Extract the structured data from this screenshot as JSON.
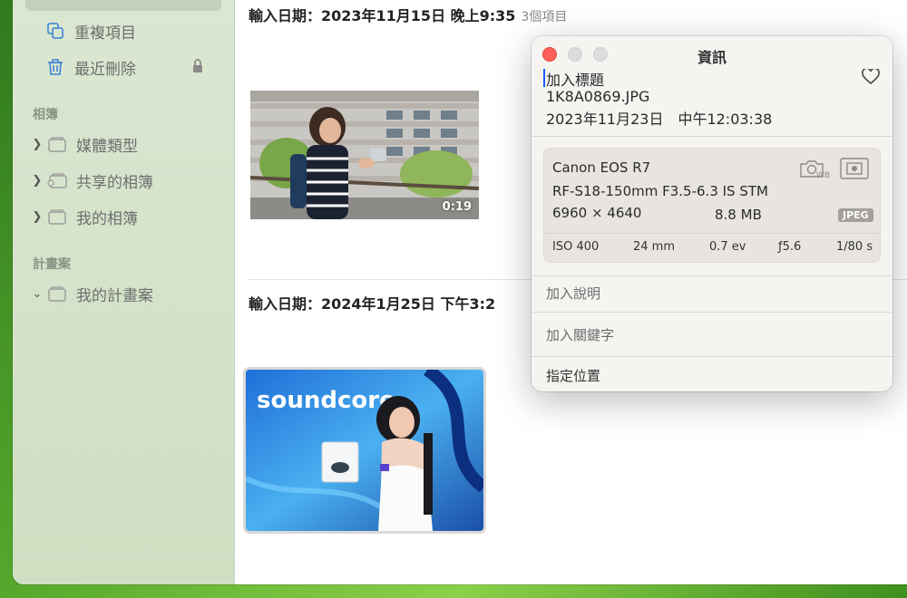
{
  "sidebar": {
    "items": [
      {
        "label": "重複項目",
        "icon": "duplicate-icon"
      },
      {
        "label": "最近刪除",
        "icon": "trash-icon"
      }
    ],
    "sections": [
      {
        "title": "相簿",
        "items": [
          {
            "label": "媒體類型",
            "icon": "folder-icon"
          },
          {
            "label": "共享的相簿",
            "icon": "shared-folder-icon"
          },
          {
            "label": "我的相簿",
            "icon": "folder-icon"
          }
        ]
      },
      {
        "title": "計畫案",
        "items": [
          {
            "label": "我的計畫案",
            "icon": "folder-icon"
          }
        ]
      }
    ]
  },
  "content": {
    "groups": [
      {
        "header": "輸入日期：2023年11月15日 晚上9:35",
        "count": "3個項目",
        "duration": "0:19"
      },
      {
        "header": "輸入日期：2024年1月25日 下午3:2",
        "count": ""
      }
    ]
  },
  "info": {
    "title": "資訊",
    "add_title": "加入標題",
    "filename": "1K8A0869.JPG",
    "datetime": "2023年11月23日　中午12:03:38",
    "camera": "Canon EOS R7",
    "lens": "RF-S18-150mm F3.5-6.3 IS STM",
    "dimensions": "6960 × 4640",
    "filesize": "8.8 MB",
    "format": "JPEG",
    "iso": "ISO 400",
    "focal": "24 mm",
    "ev": "0.7 ev",
    "aperture": "ƒ5.6",
    "shutter": "1/80 s",
    "add_description": "加入說明",
    "add_keywords": "加入關鍵字",
    "assign_location": "指定位置"
  },
  "colors": {
    "close": "#ff5f57",
    "inactive": "#dcdcdc",
    "sidebar": "#d8e5ce"
  }
}
